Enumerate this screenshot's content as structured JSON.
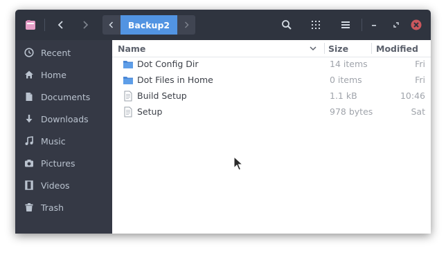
{
  "window": {
    "path": {
      "current": "Backup2"
    }
  },
  "sidebar": {
    "items": [
      {
        "label": "Recent",
        "icon": "clock-icon"
      },
      {
        "label": "Home",
        "icon": "home-icon"
      },
      {
        "label": "Documents",
        "icon": "document-icon"
      },
      {
        "label": "Downloads",
        "icon": "download-icon"
      },
      {
        "label": "Music",
        "icon": "music-icon"
      },
      {
        "label": "Pictures",
        "icon": "camera-icon"
      },
      {
        "label": "Videos",
        "icon": "film-icon"
      },
      {
        "label": "Trash",
        "icon": "trash-icon"
      }
    ]
  },
  "columns": {
    "name": "Name",
    "size": "Size",
    "modified": "Modified"
  },
  "files": [
    {
      "name": "Dot Config Dir",
      "size": "14 items",
      "modified": "Fri",
      "type": "folder"
    },
    {
      "name": "Dot Files in Home",
      "size": "0 items",
      "modified": "Fri",
      "type": "folder"
    },
    {
      "name": "Build Setup",
      "size": "1.1 kB",
      "modified": "10:46",
      "type": "text-file"
    },
    {
      "name": "Setup",
      "size": "978 bytes",
      "modified": "Sat",
      "type": "text-file"
    }
  ],
  "colors": {
    "accent": "#5294e2",
    "headerbar": "#2f343f",
    "sidebar": "#353945",
    "close": "#cc575d"
  }
}
